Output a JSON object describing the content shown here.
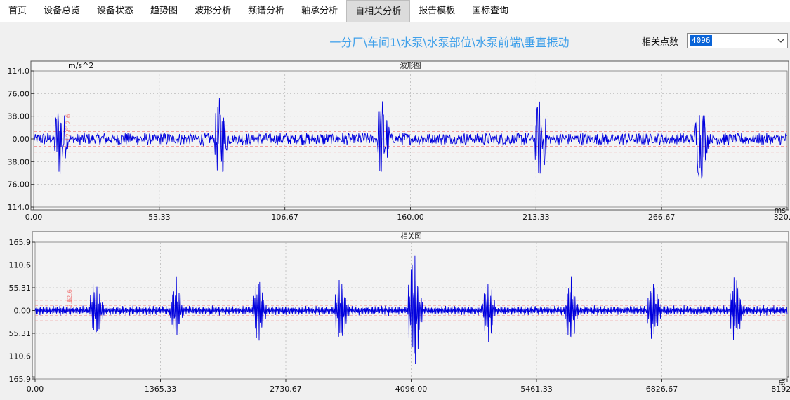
{
  "tabs": [
    "首页",
    "设备总览",
    "设备状态",
    "趋势图",
    "波形分析",
    "频谱分析",
    "轴承分析",
    "自相关分析",
    "报告模板",
    "国标查询"
  ],
  "active_tab": "自相关分析",
  "path_title": "一分厂\\车间1\\水泵\\水泵部位\\水泵前端\\垂直振动",
  "points": {
    "label": "相关点数",
    "value": "4096"
  },
  "colors": {
    "signal": "#0000dd",
    "grid": "#bbbbbb",
    "alarm": "#f08080",
    "panel_bg": "#f3f3f3"
  },
  "chart_data": [
    {
      "type": "line",
      "title": "波形图",
      "ylabel": "m/s^2",
      "xlabel": "ms",
      "xlim": [
        0,
        320
      ],
      "ylim": [
        -114,
        114
      ],
      "x_ticks": [
        "0.00",
        "53.33",
        "106.67",
        "160.00",
        "213.33",
        "266.67",
        "320.00"
      ],
      "y_ticks": [
        "114.0",
        "76.00",
        "38.00",
        "0.00",
        "38.00",
        "76.00",
        "114.0"
      ],
      "alarm_labels": [
        "12.6",
        "12.6"
      ],
      "alarm_levels": [
        -12.6,
        12.6,
        -22,
        22
      ],
      "series": [
        {
          "bursts": [
            10,
            78,
            147,
            214,
            282
          ],
          "peak": 72,
          "noise": 7
        }
      ]
    },
    {
      "type": "line",
      "title": "相关图",
      "xlabel": "点",
      "xlim": [
        0,
        8192
      ],
      "ylim": [
        -165.9,
        165.9
      ],
      "x_ticks": [
        "0.00",
        "1365.33",
        "2730.67",
        "4096.00",
        "5461.33",
        "6826.67",
        "8192.00"
      ],
      "y_ticks": [
        "165.9",
        "110.6",
        "55.31",
        "0.00",
        "55.31",
        "110.6",
        "165.9"
      ],
      "alarm_labels": [
        "12.6",
        "12.6"
      ],
      "alarm_levels": [
        -12.6,
        12.6,
        -25,
        25
      ],
      "series": [
        {
          "center": 4096,
          "peak": 160,
          "bursts": [
            630,
            1500,
            2400,
            3300,
            4096,
            4900,
            5800,
            6700,
            7600
          ],
          "noise": 9
        }
      ]
    }
  ]
}
